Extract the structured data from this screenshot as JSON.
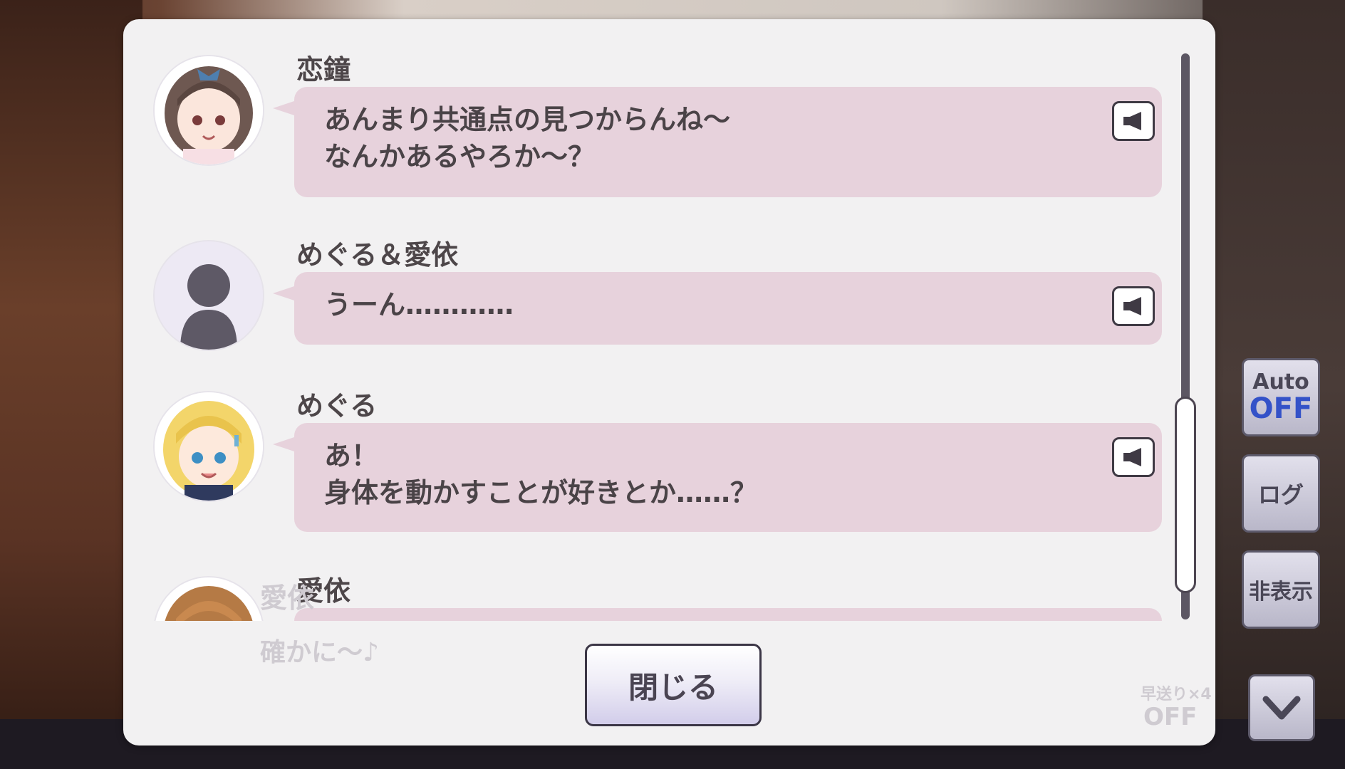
{
  "log": {
    "entries": [
      {
        "speaker": "恋鐘",
        "message": "あんまり共通点の見つからんね～\nなんかあるやろか～？"
      },
      {
        "speaker": "めぐる＆愛依",
        "message": "うーん…………"
      },
      {
        "speaker": "めぐる",
        "message": "あ！\n身体を動かすことが好きとか……？"
      },
      {
        "speaker": "愛依",
        "message": ""
      }
    ]
  },
  "close_label": "閉じる",
  "side": {
    "auto_top": "Auto",
    "auto_bottom": "OFF",
    "log_label": "ログ",
    "hide_label": "非表示"
  },
  "background": {
    "ghost_name": "愛依",
    "ghost_text": "確かに～♪",
    "ghost_ff_top": "早送り×4",
    "ghost_ff_bottom": "OFF"
  },
  "colors": {
    "bubble": "#e7d2dc",
    "panel": "#f2f1f2",
    "auto_off": "#3452c8"
  }
}
